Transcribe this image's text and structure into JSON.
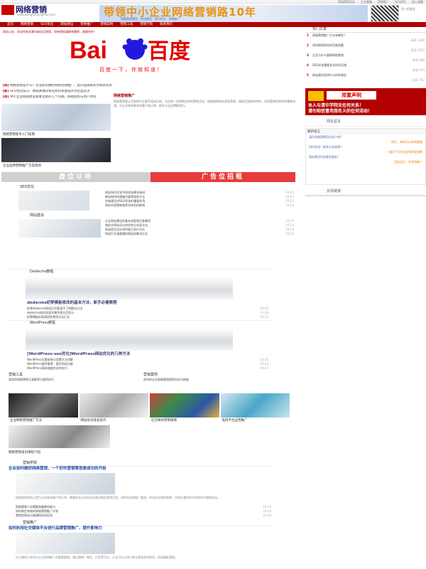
{
  "topbar": {
    "links": [
      "网络营销培训",
      "企业邮箱",
      "营销推广",
      "设为首页",
      "加入收藏"
    ]
  },
  "site": {
    "name": "网络营销",
    "url": "www.wangluoyingxiao.com"
  },
  "banner": {
    "title": "带领中小企业网络营销路10年",
    "subtitle": "网络营销策划 · 网站建设 · SEO优化 · 网络推广"
  },
  "qr_text": "扫一扫关注",
  "nav": {
    "items": [
      "首页",
      "网络营销",
      "SEO优化",
      "网站建设",
      "营销推广",
      "营销案例",
      "营销工具",
      "营销学院",
      "联系我们"
    ]
  },
  "notice": "网站公告：本站所有文章均来自互联网，如有侵权请联系删除，谢谢合作！",
  "baidu": {
    "slogan": "百度一下，你就知道！"
  },
  "list_lines": [
    {
      "tag": "[热]",
      "text": "网络营销是什么？企业如何做好网络营销推广，提升品牌影响力和转化率"
    },
    {
      "tag": "[新]",
      "text": "SEO优化技巧：网站关键词排名如何快速提升到百度首页"
    },
    {
      "tag": "[荐]",
      "text": "中小企业网站建设需要注意的几个问题，网站结构与用户体验"
    },
    {
      "tag": "[热]",
      "text": "百度竞价推广与SEO优化的区别，哪种方式更适合企业"
    }
  ],
  "photo_caps": [
    "网络营销新手入门指南",
    "企业品牌营销推广方案策划"
  ],
  "article": {
    "heading": "网络营销推广",
    "body": "网络营销是以互联网为主要手段进行的、为达到一定营销目的的营销活动。网络营销的本质是营销，借助互联网的特性，实现营销信息的传播和沟通，为企业带来更多的客户和订单，提升企业品牌影响力。"
  },
  "cta": {
    "left": "虚位以待",
    "right": "广告位招租"
  },
  "sec1": {
    "title": "SEO优化",
    "rows": [
      {
        "t": "网站SEO优化中如何选择关键词",
        "d": "10-25"
      },
      {
        "t": "新站如何快速被百度收录的方法",
        "d": "10-24"
      },
      {
        "t": "外链建设对SEO优化的重要作用",
        "d": "10-23"
      },
      {
        "t": "网站内容更新频率对排名的影响",
        "d": "10-22"
      },
      {
        "t": "百度算法更新后SEO优化的策略",
        "d": "10-21"
      }
    ]
  },
  "sec2": {
    "title": "网站建设",
    "rows": [
      {
        "t": "企业网站建设的基本流程和注意事项",
        "d": "10-25"
      },
      {
        "t": "响应式网站设计的优势与实现方法",
        "d": "10-24"
      },
      {
        "t": "网站首页设计如何吸引用户点击",
        "d": "10-23"
      },
      {
        "t": "网站打开速度慢的原因及解决方法",
        "d": "10-22"
      }
    ]
  },
  "sidebar": {
    "head": "热门文章",
    "items": [
      {
        "n": "1",
        "t": "网络营销推广方法有哪些？",
        "m": "阅读 1286"
      },
      {
        "n": "2",
        "t": "如何提高网站的百度权重",
        "m": "阅读 1035"
      },
      {
        "n": "3",
        "t": "企业为什么要做网络营销",
        "m": "阅读 986"
      },
      {
        "n": "4",
        "t": "SEO优化需要多长时间见效",
        "m": "阅读 874"
      },
      {
        "n": "5",
        "t": "网站建设选择什么样的域名",
        "m": "阅读 763"
      }
    ],
    "warn": {
      "label": "郑重声明",
      "line1": "本人与清华学院无任何关系！",
      "line2": "请勿相信冒用我名义的任何活动！"
    },
    "tag_head": "网友留言",
    "chat": {
      "head": "最新留言",
      "lines": [
        {
          "t": "请问网络营销培训多少钱？",
          "r": false
        },
        {
          "t": "您好，具体可以咨询客服",
          "r": true
        },
        {
          "t": "SEO优化一般多久有效果？",
          "r": false
        },
        {
          "t": "一般3个月左右会有明显效果",
          "r": true
        },
        {
          "t": "网站建设包含哪些服务？",
          "r": false
        },
        {
          "t": "包含设计、开发和推广",
          "r": true
        }
      ]
    },
    "foot_head": "友情链接"
  },
  "card1": {
    "hd": "Dedecms教程",
    "h": "dedecms织梦模板修改的基本方法，新手必看教程",
    "rows": [
      {
        "t": "织梦dedecms网站后台登录不了的解决方法",
        "d": "10-25"
      },
      {
        "t": "dedecms如何实现文章列表分页显示",
        "d": "10-24"
      },
      {
        "t": "织梦模板标签调用的常用方法汇总",
        "d": "10-23"
      },
      {
        "t": "dedecms网站安全设置注意事项",
        "d": "10-22"
      }
    ]
  },
  "card2": {
    "hd": "WordPress教程",
    "h": "[WordPress-seo优化]WordPress网站优化的几种方法",
    "rows": [
      {
        "t": "WordPress主题安装与设置方法详解",
        "d": "10-25"
      },
      {
        "t": "WordPress插件推荐：提升网站功能",
        "d": "10-24"
      },
      {
        "t": "WordPress网站速度优化的技巧",
        "d": "10-23"
      },
      {
        "t": "WordPress固定链接设置与SEO",
        "d": "10-22"
      }
    ]
  },
  "cols3": [
    {
      "hd": "营销工具",
      "t": "常用的网络营销工具推荐与使用技巧"
    },
    {
      "hd": "营销案例",
      "t": "成功的企业网络营销案例分析与借鉴"
    }
  ],
  "strip_caps": [
    "企业网络营销推广方法",
    "网站优化排名技巧",
    "社交媒体营销策略",
    "电商平台运营推广"
  ],
  "small_cap": "网络营销培训课程介绍",
  "bottom": {
    "head": "营销学院",
    "h1": "企业如何做好网络营销，一个好的营销策划是成功的开始",
    "p1": "网络营销的核心是为企业带来客户和订单，需要结合企业的实际情况制定营销方案，选择合适的推广渠道，持续优化营销效果，才能在激烈的市场竞争中脱颖而出。",
    "rows": [
      {
        "t": "网络营销人员需要具备哪些能力",
        "d": "10-25"
      },
      {
        "t": "如何制定有效的网络营销推广计划",
        "d": "10-24"
      },
      {
        "t": "营销型网站与普通网站的区别",
        "d": "10-23"
      }
    ],
    "head2": "营销推广",
    "h2": "如何利用社交媒体平台进行品牌营销推广，提升影响力",
    "p2": "社交媒体已经成为企业营销推广的重要渠道，通过微博、微信、抖音等平台，企业可以与用户建立更紧密的联系，实现精准营销。"
  }
}
